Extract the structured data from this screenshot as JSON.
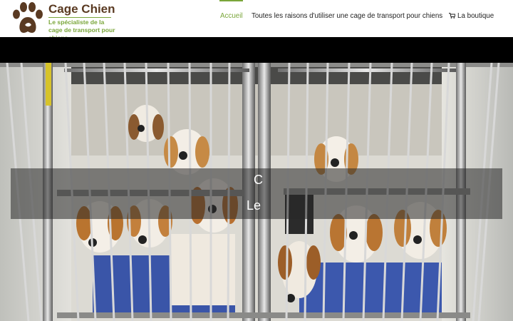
{
  "site": {
    "name": "Cage Chien",
    "tagline": "Le spécialiste de la cage de transport pour chiens",
    "logo_icon": "paw-icon",
    "colors": {
      "brand": "#5a3a22",
      "accent": "#7aa63a",
      "nav_text": "#222222"
    }
  },
  "nav": {
    "items": [
      {
        "label": "Accueil",
        "active": true
      },
      {
        "label": "Toutes les raisons d'utiliser une cage de transport pour chiens",
        "active": false
      },
      {
        "label": "La boutique",
        "active": false,
        "icon": "cart-icon"
      }
    ]
  },
  "hero": {
    "image_icon": "dogs-in-cage-photo",
    "title_visible": "C",
    "subtitle_visible": "Le"
  }
}
